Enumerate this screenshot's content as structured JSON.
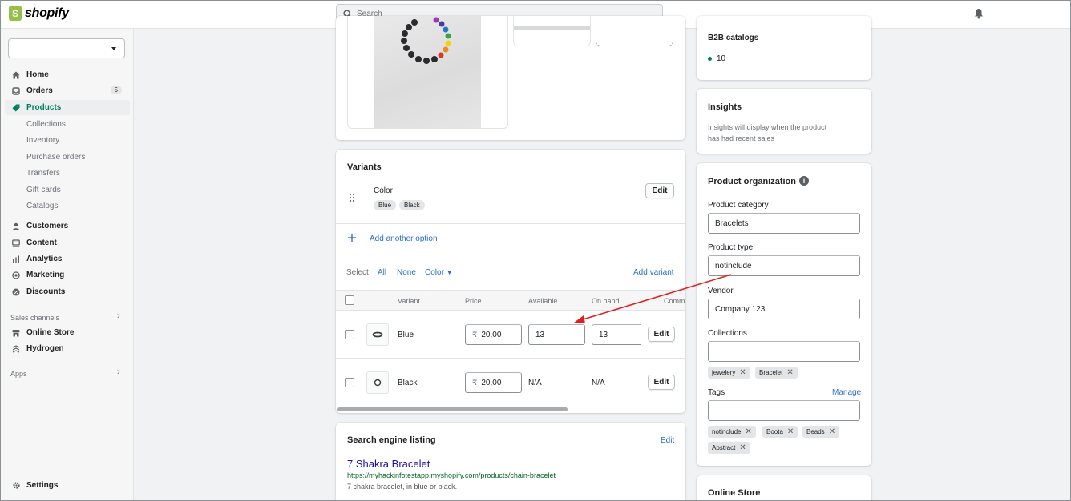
{
  "topbar": {
    "brand": "shopify",
    "search_placeholder": "Search"
  },
  "sidebar": {
    "store_select_value": "",
    "items": [
      {
        "label": "Home",
        "icon": "home-icon"
      },
      {
        "label": "Orders",
        "icon": "orders-icon",
        "badge": "5"
      },
      {
        "label": "Products",
        "icon": "tag-icon",
        "active": true
      },
      {
        "label": "Customers",
        "icon": "person-icon"
      },
      {
        "label": "Content",
        "icon": "content-icon"
      },
      {
        "label": "Analytics",
        "icon": "analytics-icon"
      },
      {
        "label": "Marketing",
        "icon": "target-icon"
      },
      {
        "label": "Discounts",
        "icon": "discount-icon"
      }
    ],
    "product_subitems": [
      "Collections",
      "Inventory",
      "Purchase orders",
      "Transfers",
      "Gift cards",
      "Catalogs"
    ],
    "sales_channels_label": "Sales channels",
    "channels": [
      {
        "label": "Online Store",
        "icon": "store-icon"
      },
      {
        "label": "Hydrogen",
        "icon": "hydrogen-icon"
      }
    ],
    "apps_label": "Apps",
    "settings_label": "Settings"
  },
  "variants": {
    "title": "Variants",
    "option_name": "Color",
    "option_values": [
      "Blue",
      "Black"
    ],
    "edit_label": "Edit",
    "add_option_label": "Add another option",
    "select_label": "Select",
    "select_all": "All",
    "select_none": "None",
    "select_color": "Color",
    "add_variant_label": "Add variant",
    "columns": [
      "Variant",
      "Price",
      "Available",
      "On hand",
      "Commi"
    ],
    "rows": [
      {
        "name": "Blue",
        "currency": "₹",
        "price": "20.00",
        "available": "13",
        "on_hand": "13",
        "edit": "Edit"
      },
      {
        "name": "Black",
        "currency": "₹",
        "price": "20.00",
        "available": "N/A",
        "on_hand": "N/A",
        "edit": "Edit"
      }
    ]
  },
  "seo": {
    "title": "Search engine listing",
    "edit_label": "Edit",
    "page_title": "7 Shakra Bracelet",
    "url": "https://myhackinfotestapp.myshopify.com/products/chain-bracelet",
    "description": "7 chakra bracelet, in blue or black."
  },
  "b2b": {
    "title": "B2B catalogs",
    "count": "10"
  },
  "insights": {
    "title": "Insights",
    "text_line1": "Insights will display when the product",
    "text_line2": "has had recent sales"
  },
  "organization": {
    "title": "Product organization",
    "category_label": "Product category",
    "category_value": "Bracelets",
    "type_label": "Product type",
    "type_value": "notinclude",
    "vendor_label": "Vendor",
    "vendor_value": "Company 123",
    "collections_label": "Collections",
    "collections_value": "",
    "collection_tags": [
      "jewelery",
      "Bracelet"
    ],
    "tags_label": "Tags",
    "tags_manage": "Manage",
    "tags_value": "",
    "tags": [
      "notinclude",
      "Boota",
      "Beads",
      "Abstract"
    ]
  },
  "online_store": {
    "title": "Online Store"
  },
  "colors": {
    "accent_green": "#007f5f",
    "link_blue": "#2c6ecb",
    "annotation_arrow": "#e02020"
  }
}
